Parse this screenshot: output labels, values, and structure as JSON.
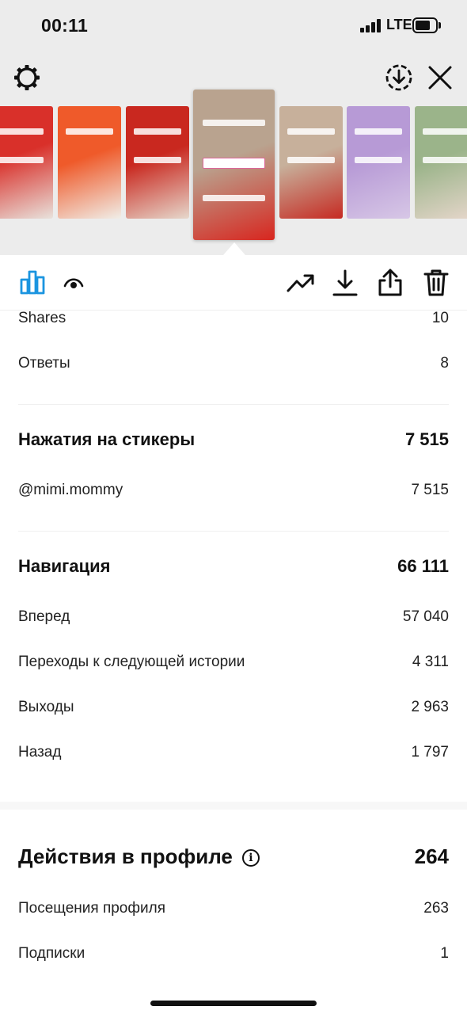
{
  "status_bar": {
    "time": "00:11",
    "network": "LTE"
  },
  "header": {
    "icons": [
      "settings-gear-icon",
      "download-circle-icon",
      "close-icon"
    ]
  },
  "thumbnails": [
    {
      "colors": [
        "#d9302a",
        "#e8e2dc"
      ],
      "stickers": 2
    },
    {
      "colors": [
        "#ef5a2a",
        "#f0eee8"
      ],
      "stickers": 1
    },
    {
      "colors": [
        "#c9281f",
        "#e6d8cc"
      ],
      "stickers": 2
    },
    {
      "colors": [
        "#b9a38f",
        "#d8261f"
      ],
      "stickers": 3,
      "active": true
    },
    {
      "colors": [
        "#c7b09b",
        "#c62a22"
      ],
      "stickers": 2
    },
    {
      "colors": [
        "#b79ad6",
        "#d7c7e6"
      ],
      "stickers": 2
    },
    {
      "colors": [
        "#9bb48a",
        "#e7d7cc"
      ],
      "stickers": 2
    }
  ],
  "toolbar": {
    "left_icons": [
      "bar-chart-icon",
      "eye-icon"
    ],
    "right_icons": [
      "trending-icon",
      "download-icon",
      "share-icon",
      "trash-icon"
    ],
    "accent_color": "#1b95e0"
  },
  "metrics": {
    "shares": {
      "label": "Shares",
      "value": "10"
    },
    "replies": {
      "label": "Ответы",
      "value": "8"
    },
    "sticker_taps": {
      "title": "Нажатия на стикеры",
      "total": "7 515",
      "items": [
        {
          "label": "@mimi.mommy",
          "value": "7 515"
        }
      ]
    },
    "navigation": {
      "title": "Навигация",
      "total": "66 111",
      "items": [
        {
          "label": "Вперед",
          "value": "57 040"
        },
        {
          "label": "Переходы к следующей истории",
          "value": "4 311"
        },
        {
          "label": "Выходы",
          "value": "2 963"
        },
        {
          "label": "Назад",
          "value": "1 797"
        }
      ]
    },
    "profile_actions": {
      "title": "Действия в профиле",
      "total": "264",
      "items": [
        {
          "label": "Посещения профиля",
          "value": "263"
        },
        {
          "label": "Подписки",
          "value": "1"
        }
      ]
    }
  }
}
